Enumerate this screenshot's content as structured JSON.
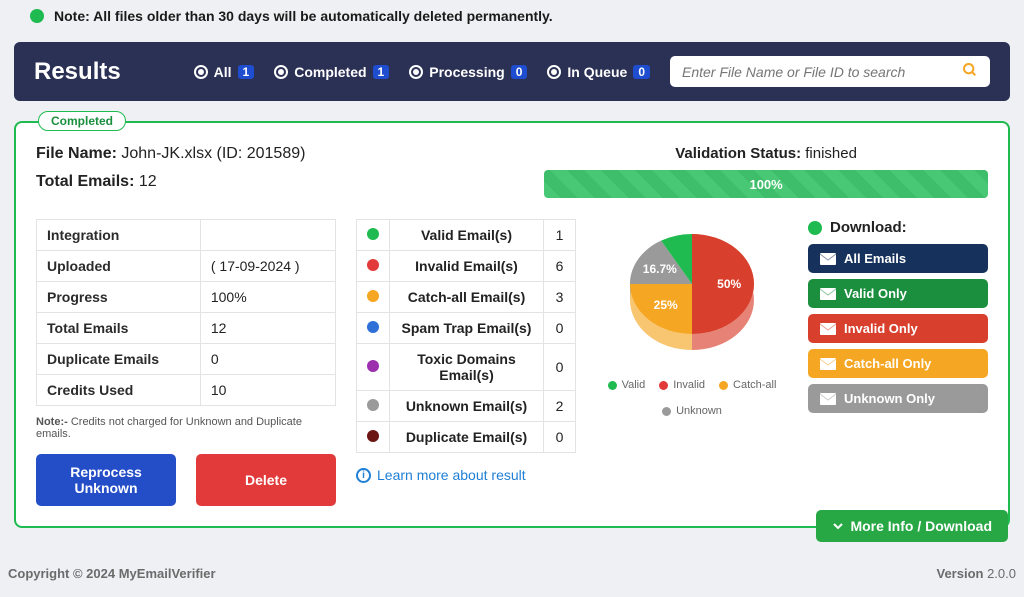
{
  "notice": "Note: All files older than 30 days will be automatically deleted permanently.",
  "header": {
    "title": "Results",
    "filters": [
      {
        "label": "All",
        "count": "1",
        "checked": true
      },
      {
        "label": "Completed",
        "count": "1",
        "checked": true
      },
      {
        "label": "Processing",
        "count": "0",
        "checked": true
      },
      {
        "label": "In Queue",
        "count": "0",
        "checked": true
      }
    ],
    "search_placeholder": "Enter File Name or File ID to search"
  },
  "card": {
    "tag": "Completed",
    "file_label": "File Name:",
    "file_value": "John-JK.xlsx (ID: 201589)",
    "total_label": "Total Emails:",
    "total_value": "12",
    "status_label": "Validation Status:",
    "status_value": "finished",
    "progress_text": "100%"
  },
  "meta_table": [
    {
      "k": "Integration",
      "v": ""
    },
    {
      "k": "Uploaded",
      "v": "( 17-09-2024 )"
    },
    {
      "k": "Progress",
      "v": "100%"
    },
    {
      "k": "Total Emails",
      "v": "12"
    },
    {
      "k": "Duplicate Emails",
      "v": "0"
    },
    {
      "k": "Credits Used",
      "v": "10"
    }
  ],
  "meta_note_b": "Note:-",
  "meta_note": " Credits not charged for Unknown and Duplicate emails.",
  "cat_table": [
    {
      "color": "#1fbb50",
      "label": "Valid Email(s)",
      "count": "1"
    },
    {
      "color": "#e23a3a",
      "label": "Invalid Email(s)",
      "count": "6"
    },
    {
      "color": "#f5a623",
      "label": "Catch-all Email(s)",
      "count": "3"
    },
    {
      "color": "#2e6fd8",
      "label": "Spam Trap Email(s)",
      "count": "0"
    },
    {
      "color": "#9b2fae",
      "label": "Toxic Domains Email(s)",
      "count": "0"
    },
    {
      "color": "#9a9a9a",
      "label": "Unknown Email(s)",
      "count": "2"
    },
    {
      "color": "#6b1515",
      "label": "Duplicate Email(s)",
      "count": "0"
    }
  ],
  "actions": {
    "reprocess": "Reprocess Unknown",
    "delete": "Delete",
    "learn": "Learn more about result"
  },
  "legend": [
    {
      "color": "#1fbb50",
      "label": "Valid"
    },
    {
      "color": "#e23a3a",
      "label": "Invalid"
    },
    {
      "color": "#f5a623",
      "label": "Catch-all"
    },
    {
      "color": "#9a9a9a",
      "label": "Unknown"
    }
  ],
  "download": {
    "title": "Download:",
    "buttons": [
      {
        "label": "All Emails",
        "bg": "#16325c"
      },
      {
        "label": "Valid Only",
        "bg": "#1b8f3e"
      },
      {
        "label": "Invalid Only",
        "bg": "#d8402d"
      },
      {
        "label": "Catch-all Only",
        "bg": "#f5a623"
      },
      {
        "label": "Unknown Only",
        "bg": "#9a9a9a"
      }
    ]
  },
  "more_btn": "More Info / Download",
  "footer": {
    "copyright": "Copyright © 2024 MyEmailVerifier",
    "version_label": "Version ",
    "version_value": "2.0.0"
  },
  "chart_data": {
    "type": "pie",
    "title": "",
    "series": [
      {
        "name": "Invalid",
        "value": 50,
        "color": "#d8402d",
        "label": "50%"
      },
      {
        "name": "Catch-all",
        "value": 25,
        "color": "#f5a623",
        "label": "25%"
      },
      {
        "name": "Unknown",
        "value": 16.7,
        "color": "#9a9a9a",
        "label": "16.7%"
      },
      {
        "name": "Valid",
        "value": 8.3,
        "color": "#1fbb50",
        "label": ""
      }
    ]
  }
}
